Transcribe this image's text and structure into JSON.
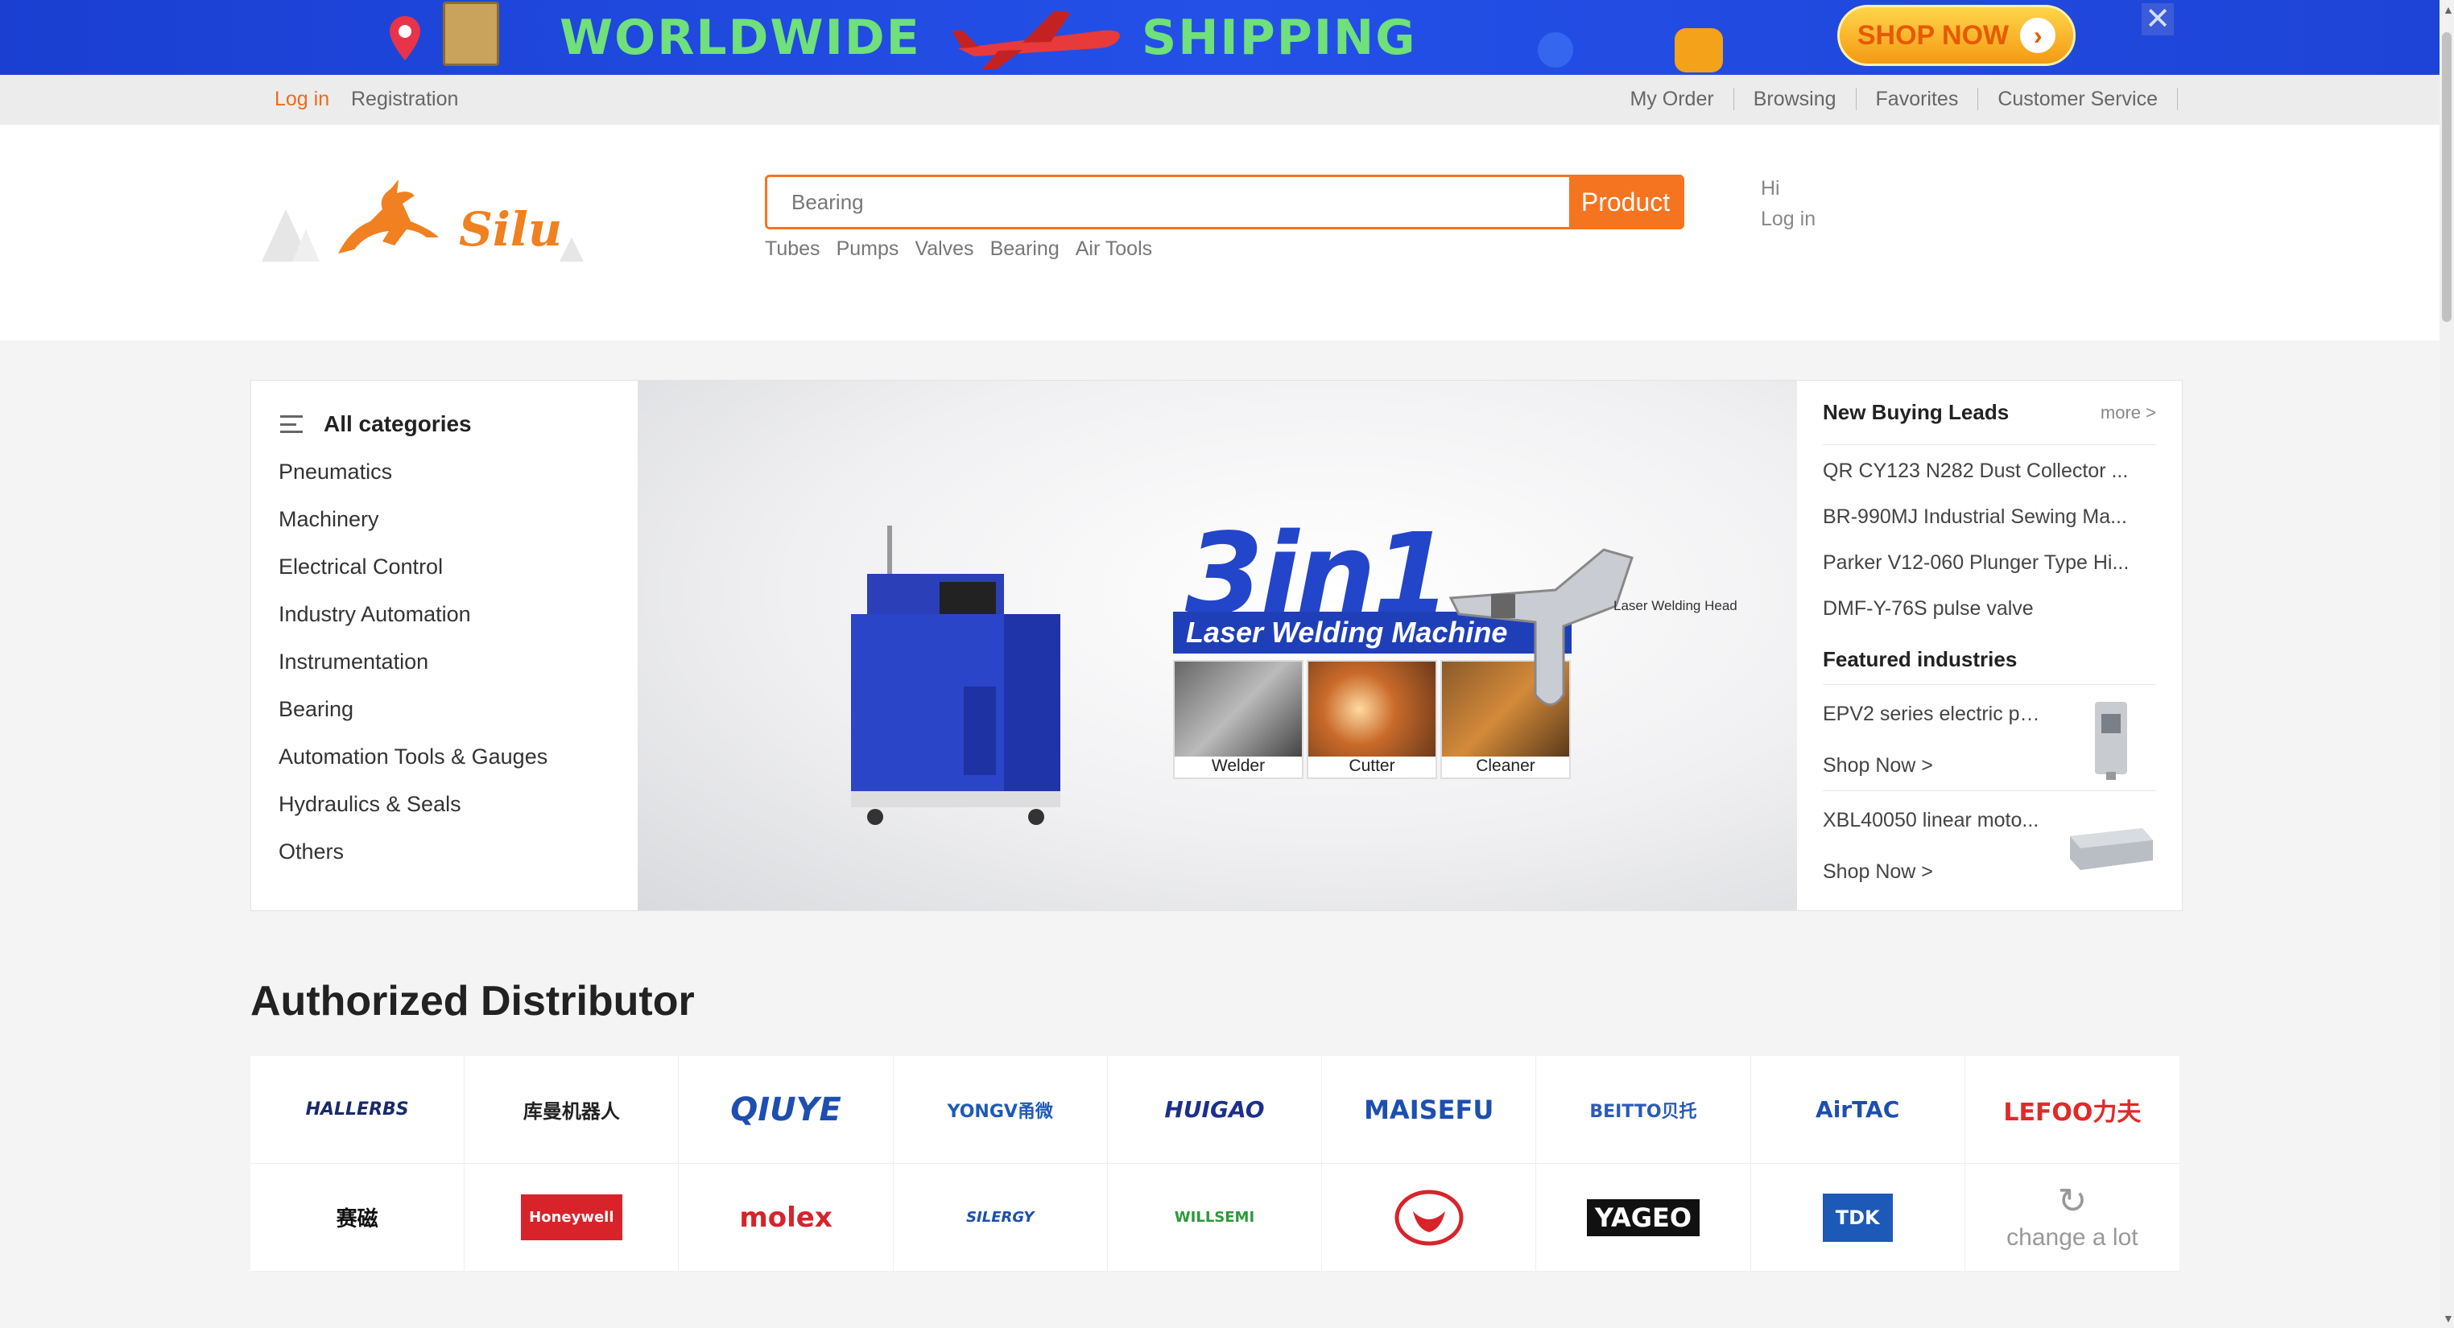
{
  "promo": {
    "text_left": "WORLDWIDE",
    "text_right": "SHIPPING",
    "shop_label": "SHOP NOW",
    "close_glyph": "✕"
  },
  "topbar": {
    "login": "Log in",
    "registration": "Registration",
    "links": [
      "My Order",
      "Browsing",
      "Favorites",
      "Customer Service"
    ]
  },
  "header": {
    "logo_text": "Silu",
    "search_placeholder": "Bearing",
    "search_button": "Product",
    "hot_words": [
      "Tubes",
      "Pumps",
      "Valves",
      "Bearing",
      "Air Tools"
    ],
    "greeting": "Hi",
    "login": "Log in"
  },
  "categories": {
    "title": "All categories",
    "items": [
      "Pneumatics",
      "Machinery",
      "Electrical Control",
      "Industry Automation",
      "Instrumentation",
      "Bearing",
      "Automation Tools & Gauges",
      "Hydraulics & Seals",
      "Others"
    ]
  },
  "hero": {
    "big": "3in1",
    "band": "Laser Welding Machine",
    "tiles": [
      "Welder",
      "Cutter",
      "Cleaner"
    ],
    "head_label": "Laser Welding Head"
  },
  "leads": {
    "title": "New Buying Leads",
    "more": "more >",
    "items": [
      "QR CY123 N282 Dust Collector ...",
      "BR-990MJ Industrial Sewing Ma...",
      "Parker V12-060 Plunger Type Hi...",
      "DMF-Y-76S pulse valve"
    ],
    "featured_title": "Featured industries",
    "featured": [
      {
        "name": "EPV2 series electric pr...",
        "shop": "Shop Now >"
      },
      {
        "name": "XBL40050 linear moto...",
        "shop": "Shop Now >"
      }
    ]
  },
  "distributors": {
    "title": "Authorized Distributor",
    "brands_row1": [
      "HALLERBS",
      "库曼机器人",
      "QIUYE",
      "YONGV甬微",
      "HUIGAO",
      "MAISEFU",
      "BEITTO贝托",
      "AirTAC",
      "LEFOO力夫"
    ],
    "brands_row2": [
      "赛磁",
      "Honeywell",
      "molex",
      "SILERGY",
      "WILLSEMI",
      "",
      "YAGEO",
      "TDK"
    ],
    "change_label": "change a lot"
  },
  "colors": {
    "accent": "#f5741f",
    "banner_blue": "#2450e8",
    "hero_blue": "#2345c9"
  }
}
